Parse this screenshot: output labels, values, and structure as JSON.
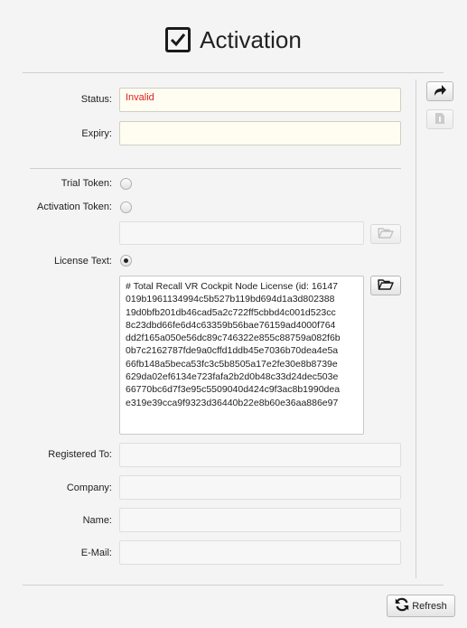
{
  "title": "Activation",
  "fields": {
    "status_label": "Status:",
    "status_value": "Invalid",
    "expiry_label": "Expiry:",
    "expiry_value": "",
    "trial_token_label": "Trial Token:",
    "activation_token_label": "Activation Token:",
    "activation_token_value": "",
    "license_text_label": "License Text:",
    "registered_to_label": "Registered To:",
    "registered_to_value": "",
    "company_label": "Company:",
    "company_value": "",
    "name_label": "Name:",
    "name_value": "",
    "email_label": "E-Mail:",
    "email_value": ""
  },
  "license_lines": [
    "# Total Recall VR Cockpit Node License (id: 16147",
    "019b1961134994c5b527b119bd694d1a3d802388",
    "19d0bfb201db46cad5a2c722ff5cbbd4c001d523cc",
    "8c23dbd66fe6d4c63359b56bae76159ad4000f764",
    "dd2f165a050e56dc89c746322e855c88759a082f6b",
    "0b7c2162787fde9a0cffd1ddb45e7036b70dea4e5a",
    "66fb148a5beca53fc3c5b8505a17e2fe30e8b8739e",
    "629da02ef6134e723fafa2b2d0b48c33d24dec503e",
    "66770bc6d7f3e95c5509040d424c9f3ac8b1990dea",
    "e319e39cca9f9323d36440b22e8b60e36aa886e97"
  ],
  "selected_mode": "license_text",
  "refresh_label": "Refresh",
  "icons": {
    "title": "checkbox-icon",
    "side_top": "share-icon",
    "side_second": "document-icon",
    "folder": "folder-open-icon",
    "refresh": "refresh-icon"
  },
  "colors": {
    "invalid_text": "#e02020",
    "highlight_field": "#fffdf1"
  }
}
